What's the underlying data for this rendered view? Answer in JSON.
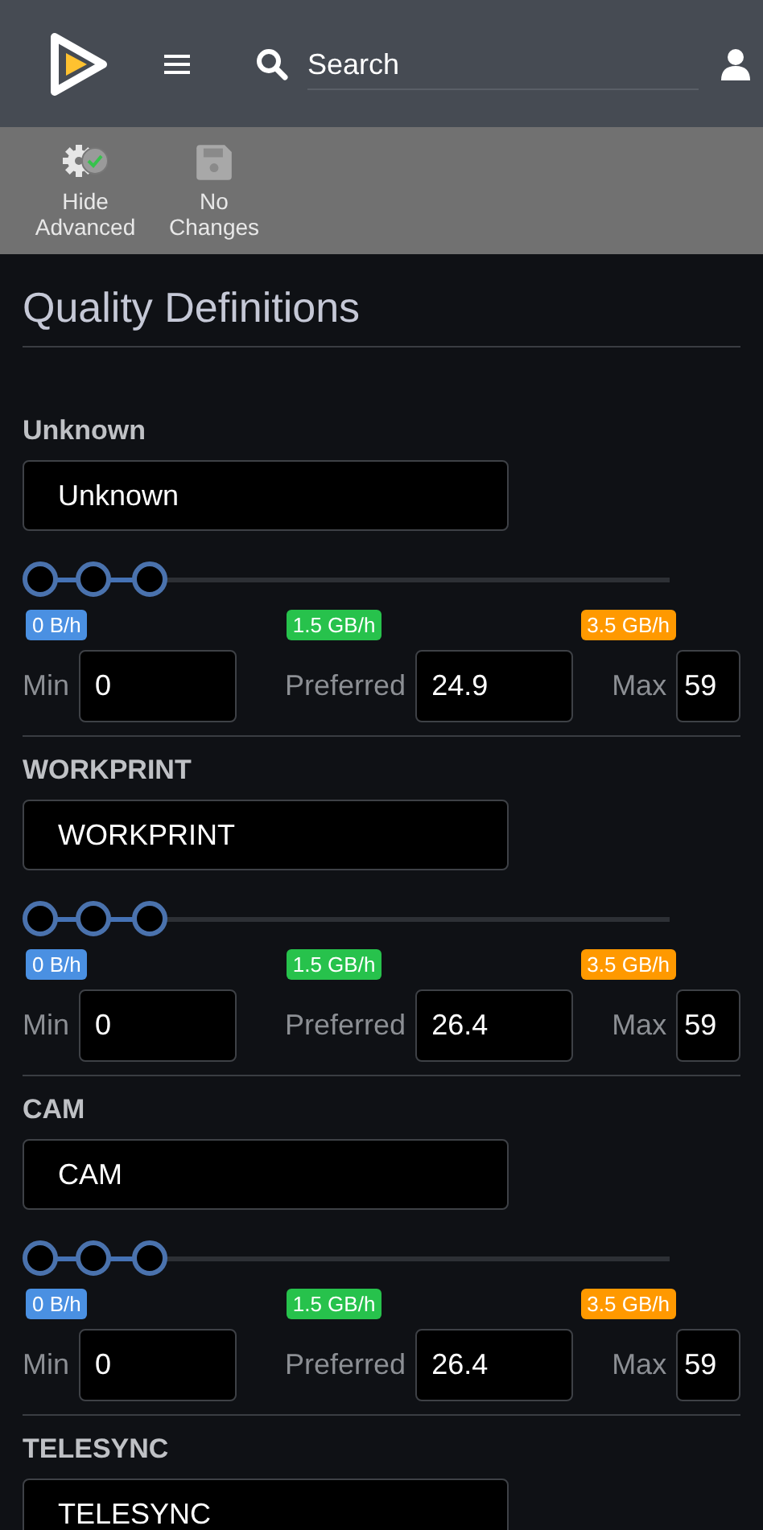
{
  "header": {
    "search": {
      "placeholder": "Search"
    }
  },
  "toolbar": [
    {
      "kind": "advanced",
      "label": "Hide Advanced"
    },
    {
      "kind": "save",
      "label": "No Changes"
    }
  ],
  "title": "Quality Definitions",
  "definitions": [
    {
      "name": "Unknown",
      "title": "Unknown",
      "thumbs": [
        {
          "level": 0
        },
        {
          "level": 0.087
        },
        {
          "level": 0.18
        }
      ],
      "badges": [
        {
          "text": "0 B/h",
          "color": "#4a90e2"
        },
        {
          "text": "1.5 GB/h",
          "color": "#27c24c"
        },
        {
          "text": "3.5 GB/h",
          "color": "#ff9900"
        }
      ],
      "min_label": "Min",
      "min": "0",
      "preferred_label": "Preferred",
      "preferred": "24.9",
      "max_label": "Max",
      "max": "59"
    },
    {
      "name": "WORKPRINT",
      "title": "WORKPRINT",
      "thumbs": [
        {
          "level": 0
        },
        {
          "level": 0.087
        },
        {
          "level": 0.18
        }
      ],
      "badges": [
        {
          "text": "0 B/h",
          "color": "#4a90e2"
        },
        {
          "text": "1.5 GB/h",
          "color": "#27c24c"
        },
        {
          "text": "3.5 GB/h",
          "color": "#ff9900"
        }
      ],
      "min_label": "Min",
      "min": "0",
      "preferred_label": "Preferred",
      "preferred": "26.4",
      "max_label": "Max",
      "max": "59"
    },
    {
      "name": "CAM",
      "title": "CAM",
      "thumbs": [
        {
          "level": 0
        },
        {
          "level": 0.087
        },
        {
          "level": 0.18
        }
      ],
      "badges": [
        {
          "text": "0 B/h",
          "color": "#4a90e2"
        },
        {
          "text": "1.5 GB/h",
          "color": "#27c24c"
        },
        {
          "text": "3.5 GB/h",
          "color": "#ff9900"
        }
      ],
      "min_label": "Min",
      "min": "0",
      "preferred_label": "Preferred",
      "preferred": "26.4",
      "max_label": "Max",
      "max": "59"
    },
    {
      "name": "TELESYNC",
      "title": "TELESYNC"
    }
  ]
}
